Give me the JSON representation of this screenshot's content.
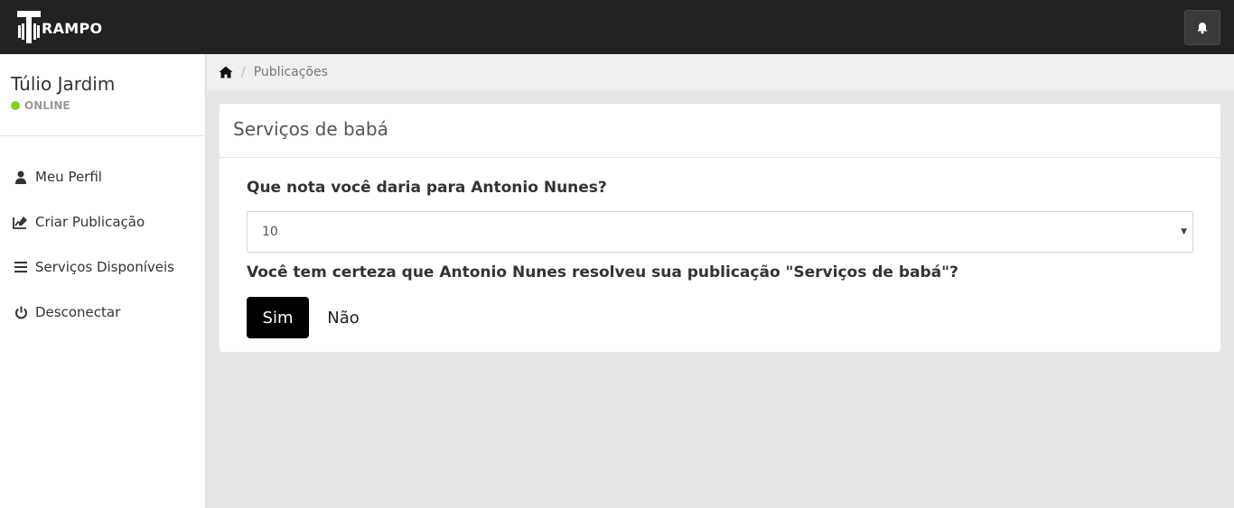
{
  "header": {
    "logo_text": "RAMPO",
    "logo_icon": "hammer-logo-icon",
    "notification_icon": "bell-icon"
  },
  "sidebar": {
    "user_name": "Túlio Jardim",
    "status": "ONLINE",
    "status_color": "#7ed321",
    "items": [
      {
        "label": "Meu Perfil",
        "icon": "user-icon"
      },
      {
        "label": "Criar Publicação",
        "icon": "edit-chart-icon"
      },
      {
        "label": "Serviços Disponíveis",
        "icon": "list-icon"
      },
      {
        "label": "Desconectar",
        "icon": "power-icon"
      }
    ]
  },
  "breadcrumb": {
    "home_icon": "home-icon",
    "current": "Publicações"
  },
  "panel": {
    "title": "Serviços de babá",
    "rating_question": "Que nota você daria para Antonio Nunes?",
    "rating_value": "10",
    "confirm_question": "Você tem certeza que Antonio Nunes resolveu sua publicação \"Serviços de babá\"?",
    "yes_label": "Sim",
    "no_label": "Não",
    "yes_color": "#000000"
  }
}
